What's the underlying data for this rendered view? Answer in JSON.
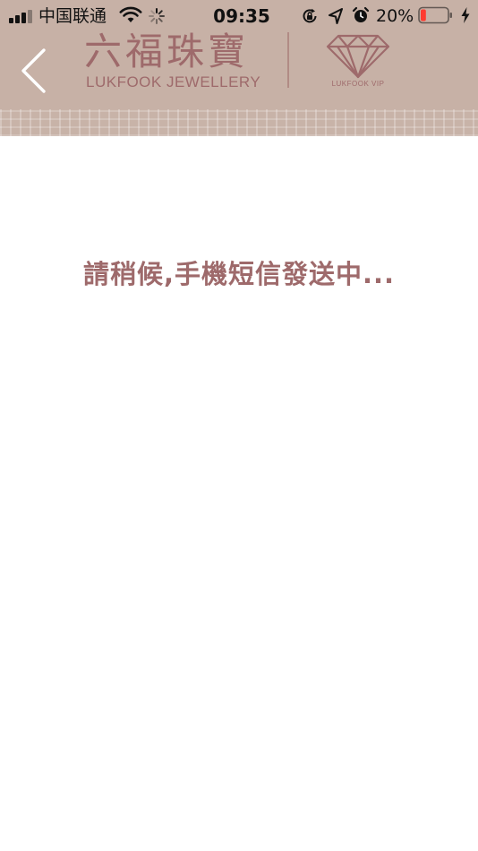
{
  "status_bar": {
    "carrier": "中国联通",
    "time": "09:35",
    "battery_percent": "20%",
    "signal_bars": 3,
    "battery_level": 0.2,
    "battery_color": "#ff3b30"
  },
  "header": {
    "brand_cn": "六福珠寶",
    "brand_en": "LUKFOOK JEWELLERY",
    "vip_label": "LUKFOOK VIP",
    "back_icon": "chevron-left-icon",
    "background_color": "#c7b1a6",
    "brand_color": "#9e6a6b"
  },
  "content": {
    "message": "請稍候,手機短信發送中..."
  }
}
